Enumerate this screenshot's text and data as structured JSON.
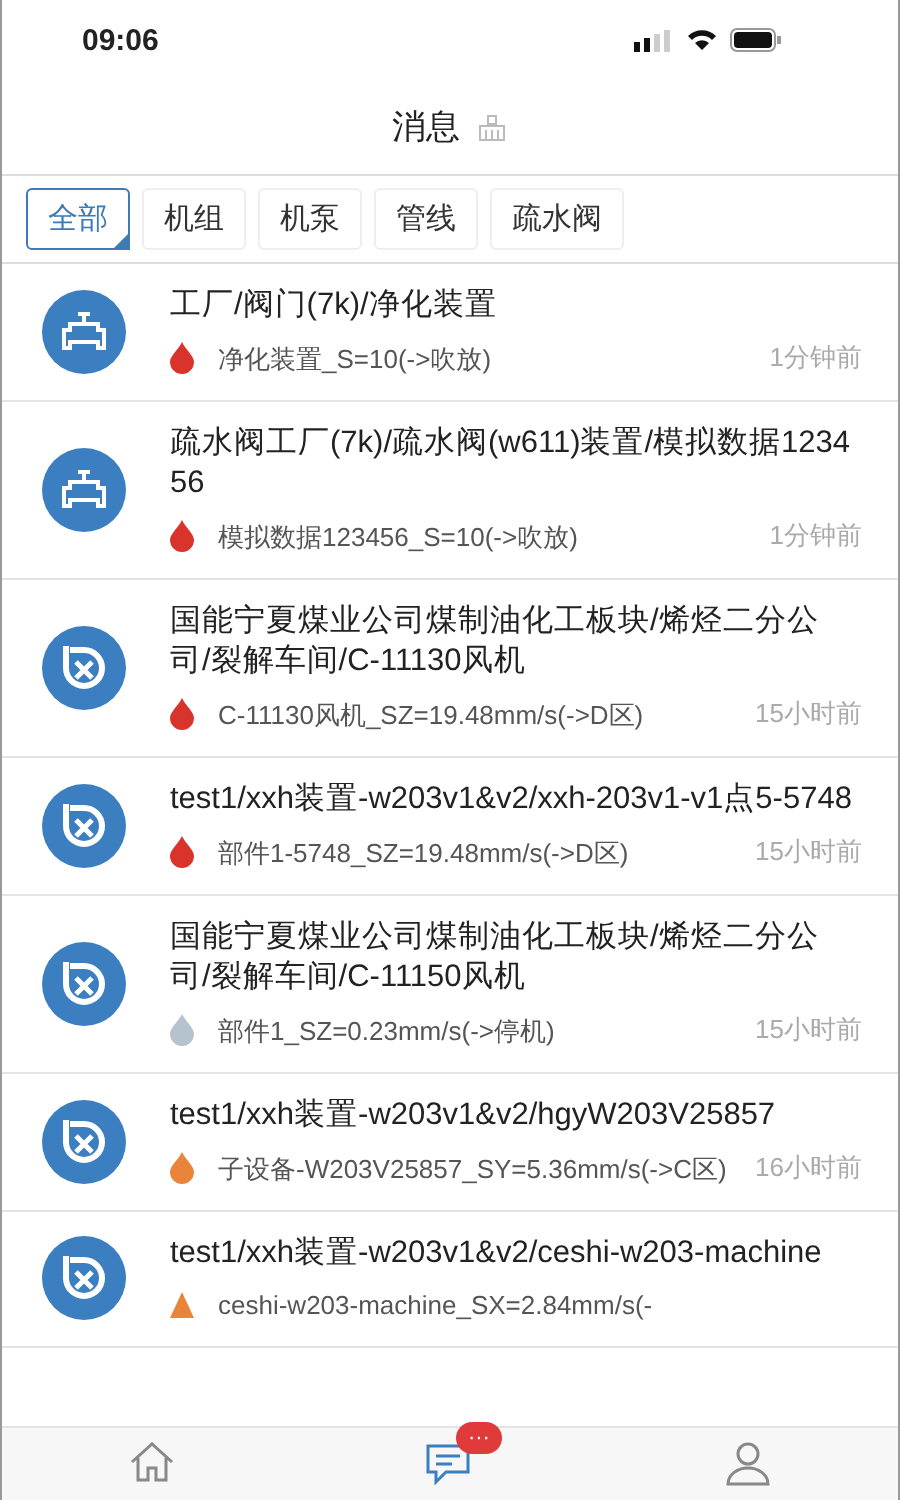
{
  "status_bar": {
    "time": "09:06"
  },
  "header": {
    "title": "消息"
  },
  "filter_tabs": [
    {
      "label": "全部",
      "selected": true
    },
    {
      "label": "机组",
      "selected": false
    },
    {
      "label": "机泵",
      "selected": false
    },
    {
      "label": "管线",
      "selected": false
    },
    {
      "label": "疏水阀",
      "selected": false
    }
  ],
  "messages": [
    {
      "kind": "valve",
      "title": "工厂/阀门(7k)/净化装置",
      "alarm": {
        "kind": "drop",
        "color": "#d9342b"
      },
      "detail": "净化装置_S=10(->吹放)",
      "time": "1分钟前"
    },
    {
      "kind": "valve",
      "title": "疏水阀工厂(7k)/疏水阀(w611)装置/模拟数据123456",
      "alarm": {
        "kind": "drop",
        "color": "#d9342b"
      },
      "detail": "模拟数据123456_S=10(->吹放)",
      "time": "1分钟前"
    },
    {
      "kind": "fan",
      "title": "国能宁夏煤业公司煤制油化工板块/烯烃二分公司/裂解车间/C-11130风机",
      "alarm": {
        "kind": "drop",
        "color": "#d9342b"
      },
      "detail": "C-11130风机_SZ=19.48mm/s(->D区)",
      "time": "15小时前"
    },
    {
      "kind": "fan",
      "title": "test1/xxh装置-w203v1&v2/xxh-203v1-v1点5-5748",
      "alarm": {
        "kind": "drop",
        "color": "#d9342b"
      },
      "detail": "部件1-5748_SZ=19.48mm/s(->D区)",
      "time": "15小时前"
    },
    {
      "kind": "fan",
      "title": "国能宁夏煤业公司煤制油化工板块/烯烃二分公司/裂解车间/C-11150风机",
      "alarm": {
        "kind": "drop",
        "color": "#b4c3cf"
      },
      "detail": "部件1_SZ=0.23mm/s(->停机)",
      "time": "15小时前"
    },
    {
      "kind": "fan",
      "title": "test1/xxh装置-w203v1&v2/hgyW203V25857",
      "alarm": {
        "kind": "drop",
        "color": "#e8853a"
      },
      "detail": "子设备-W203V25857_SY=5.36mm/s(->C区)",
      "time": "16小时前"
    },
    {
      "kind": "fan",
      "title": "test1/xxh装置-w203v1&v2/ceshi-w203-machine",
      "alarm": {
        "kind": "triangle",
        "color": "#e8853a"
      },
      "detail": "ceshi-w203-machine_SX=2.84mm/s(-"
    }
  ],
  "bottom_nav": [
    {
      "kind": "home",
      "selected": false
    },
    {
      "kind": "messages",
      "selected": true,
      "badge": "···"
    },
    {
      "kind": "profile",
      "selected": false
    }
  ]
}
